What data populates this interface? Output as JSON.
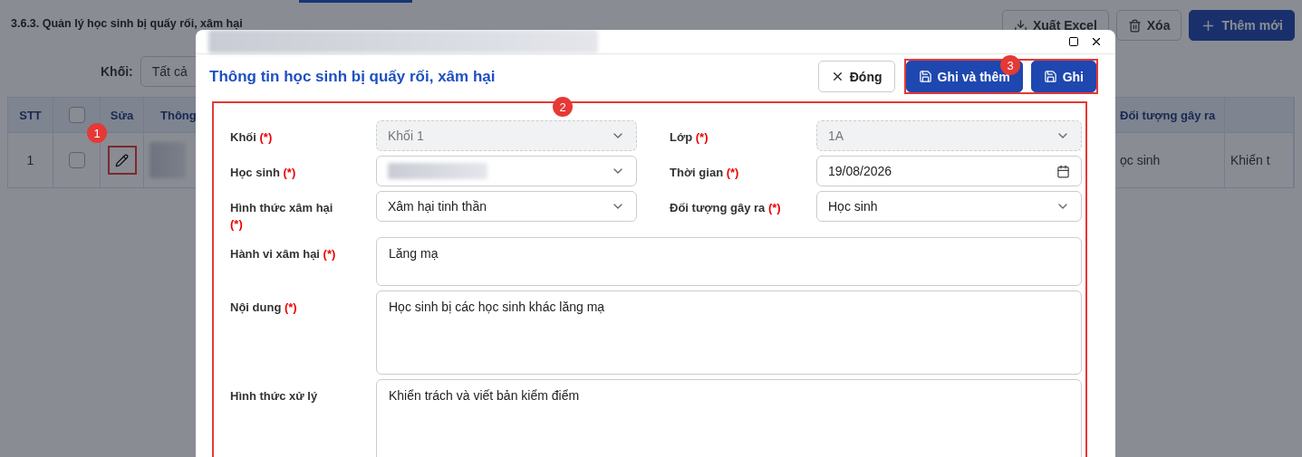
{
  "page": {
    "title": "3.6.3. Quản lý học sinh bị quấy rối, xâm hại",
    "actions": [
      {
        "label": "Xuất Excel",
        "kind": "export"
      },
      {
        "label": "Xóa",
        "kind": "delete"
      },
      {
        "label": "Thêm mới",
        "kind": "add"
      }
    ],
    "filter": {
      "label": "Khối:",
      "value": "Tất cả"
    },
    "table": {
      "columns": [
        "STT",
        "",
        "Sửa",
        "Thông",
        "Đối tượng gây ra",
        ""
      ],
      "all_checked": false,
      "rows": [
        {
          "stt": "1",
          "checked": false,
          "column_5": "ọc sinh",
          "column_6": "Khiển t"
        }
      ]
    }
  },
  "modal": {
    "heading": "Thông tin học sinh bị quấy rối, xâm hại",
    "buttons": [
      {
        "label": "Đóng",
        "kind": "close"
      },
      {
        "label": "Ghi và thêm",
        "kind": "save"
      },
      {
        "label": "Ghi",
        "kind": "save"
      }
    ],
    "fields": [
      {
        "label": "Khối",
        "required": "(*)",
        "kind": "select",
        "value": "Khối 1",
        "disabled": true
      },
      {
        "label": "Lớp",
        "required": "(*)",
        "kind": "select",
        "value": "1A",
        "disabled": true
      },
      {
        "label": "Học sinh",
        "required": "(*)",
        "kind": "select",
        "disabled": false
      },
      {
        "label": "Thời gian",
        "required": "(*)",
        "kind": "date",
        "value": "19/08/2026",
        "disabled": false
      },
      {
        "label": "Hình thức xâm hại",
        "required": "(*)",
        "kind": "select",
        "value": "Xâm hại tinh thần",
        "disabled": false
      },
      {
        "label": "Đối tượng gây ra",
        "required": "(*)",
        "kind": "select",
        "value": "Học sinh",
        "disabled": false
      },
      {
        "label": "Hành vi xâm hại",
        "required": "(*)",
        "kind": "textarea",
        "value": "Lăng mạ",
        "disabled": false
      },
      {
        "label": "Nội dung",
        "required": "(*)",
        "kind": "textarea",
        "value": "Học sinh bị các học sinh khác lăng mạ",
        "disabled": false
      },
      {
        "label": "Hình thức xử lý",
        "kind": "textarea",
        "value": "Khiển trách và viết bản kiểm điểm",
        "disabled": false
      }
    ]
  },
  "annotations": [
    {
      "number": "1"
    },
    {
      "number": "2"
    },
    {
      "number": "3"
    }
  ]
}
